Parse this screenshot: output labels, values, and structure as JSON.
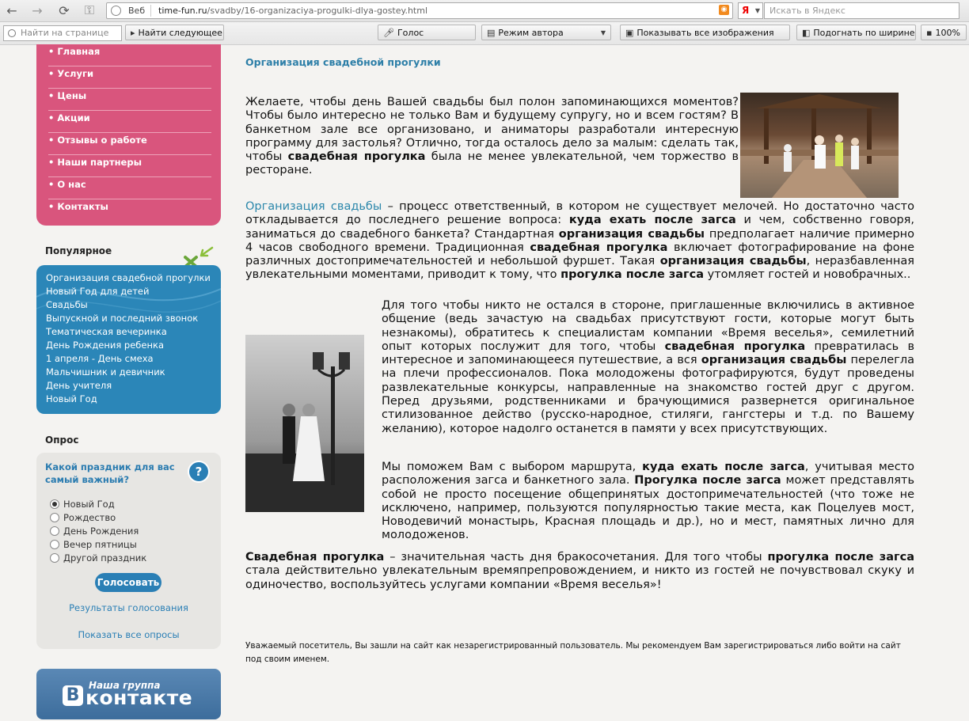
{
  "browser": {
    "back": "←",
    "forward": "→",
    "reload": "⟳",
    "key": "⚿",
    "site_label": "Веб",
    "url_domain": "time-fun.ru",
    "url_path": "/svadby/16-organizaciya-progulki-dlya-gostey.html",
    "rss": "◉",
    "search_engine": "Я",
    "search_placeholder": "Искать в Яндекс",
    "find_placeholder": "Найти на странице",
    "find_next": "Найти следующее",
    "voice": "Голос",
    "author_mode": "Режим автора",
    "show_images": "Показывать все изображения",
    "fit_width": "Подогнать по ширине",
    "zoom": "100%"
  },
  "menu": [
    "• Главная",
    "• Услуги",
    "• Цены",
    "• Акции",
    "• Отзывы о работе",
    "• Наши партнеры",
    "• О нас",
    "• Контакты"
  ],
  "popular": {
    "title": "Популярное",
    "items": [
      "Организация свадебной прогулки",
      "Новый Год для детей",
      "Свадьбы",
      "Выпускной и последний звонок",
      "Тематическая вечеринка",
      "День Рождения ребенка",
      "1 апреля - День смеха",
      "Мальчишник и девичник",
      "День учителя",
      "Новый Год"
    ]
  },
  "poll": {
    "title": "Опрос",
    "question": "Какой праздник для вас самый важный?",
    "help": "?",
    "options": [
      "Новый Год",
      "Рождество",
      "День Рождения",
      "Вечер пятницы",
      "Другой праздник"
    ],
    "selected": 0,
    "vote": "Голосовать",
    "results": "Результаты голосования",
    "all_polls": "Показать все опросы"
  },
  "vk": {
    "small": "Наша группа",
    "logo": "В",
    "big": "контакте"
  },
  "article": {
    "title": "Организация свадебной прогулки",
    "p1": [
      {
        "t": "        Желаете, чтобы день Вашей свадьбы был полон запоминающихся моментов? Чтобы было интересно не только Вам и будущему супругу, но и всем гостям? В банкетном зале все организовано, и аниматоры разработали интересную программу для застолья? Отлично, тогда осталось дело за малым: сделать так, чтобы "
      },
      {
        "b": "свадебная прогулка"
      },
      {
        "t": " была не менее увлекательной, чем торжество в ресторане."
      }
    ],
    "p2": [
      {
        "l": "Организация свадьбы"
      },
      {
        "t": " – процесс ответственный, в котором не существует мелочей. Но достаточно часто откладывается до последнего решение вопроса:  "
      },
      {
        "b": "куда ехать после загса"
      },
      {
        "t": " и чем, собственно говоря,  заниматься до свадебного банкета? Стандартная "
      },
      {
        "b": "организация свадьбы"
      },
      {
        "t": " предполагает наличие примерно 4 часов свободного времени.  Традиционная "
      },
      {
        "b": "свадебная прогулка"
      },
      {
        "t": " включает фотографирование на фоне различных достопримечательностей и небольшой фуршет. Такая "
      },
      {
        "b": "организация свадьбы"
      },
      {
        "t": ",  неразбавленная увлекательными моментами, приводит к тому, что "
      },
      {
        "b": "прогулка после загса"
      },
      {
        "t": " утомляет гостей и новобрачных.."
      }
    ],
    "p3": [
      {
        "t": " Для того чтобы никто не остался в стороне, приглашенные включились в активное общение (ведь зачастую на свадьбах присутствуют гости, которые могут быть незнакомы), обратитесь к специалистам компании «Время веселья», семилетний опыт которых послужит для того, чтобы "
      },
      {
        "b": "свадебная прогулка"
      },
      {
        "t": " превратилась в интересное и запоминающееся путешествие, а вся "
      },
      {
        "b": "организация свадьбы"
      },
      {
        "t": " перелегла на плечи профессионалов. Пока молодожены фотографируются, будут проведены развлекательные конкурсы, направленные на знакомство гостей друг с другом. Перед друзьями, родственниками и брачующимися развернется оригинальное стилизованное действо (русско-народное, стиляги, гангстеры и т.д. по Вашему желанию), которое надолго останется в памяти у всех присутствующих."
      }
    ],
    "p4": [
      {
        "t": " Мы поможем Вам с выбором маршрута, "
      },
      {
        "b": "куда ехать после загса"
      },
      {
        "t": ", учитывая место расположения загса и банкетного зала. "
      },
      {
        "b": "Прогулка после загса"
      },
      {
        "t": " может представлять собой не просто посещение общепринятых достопримечательностей (что тоже не исключено, например, пользуются популярностью такие места, как Поцелуев мост, Новодевичий монастырь, Красная площадь и др.), но и мест, памятных лично для молодоженов."
      }
    ],
    "p5": [
      {
        "b": "Свадебная прогулка"
      },
      {
        "t": " – значительная часть дня бракосочетания. Для того чтобы "
      },
      {
        "b": "прогулка после загса"
      },
      {
        "t": " стала действительно увлекательным времяпрепровождением, и никто из гостей не почувствовал скуку и одиночество, воспользуйтесь услугами  компании «Время веселья»!"
      }
    ],
    "footer": "Уважаемый посетитель, Вы зашли на сайт как незарегистрированный пользователь. Мы рекомендуем Вам зарегистрироваться либо войти на сайт под своим именем."
  },
  "colors": {
    "menu_bg": "#d9557d",
    "popular_bg": "#2b86b8",
    "poll_bg": "#e7e6e3",
    "link": "#2b87ab",
    "page_bg": "#f4f3f1"
  }
}
